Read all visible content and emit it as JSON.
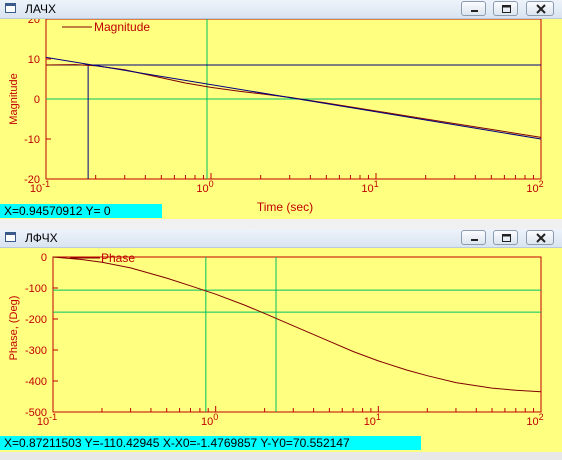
{
  "windows": [
    {
      "title": "ЛАЧХ",
      "legend": "Magnitude",
      "ylabel": "Magnitude",
      "xlabel": "Time (sec)",
      "status": "X=0.94570912  Y=       0",
      "y_ticks": [
        "20",
        "10",
        "0",
        "-10",
        "-20"
      ],
      "x_ticks": [
        {
          "base": "10",
          "exp": "-1"
        },
        {
          "base": "10",
          "exp": "0"
        },
        {
          "base": "10",
          "exp": "1"
        },
        {
          "base": "10",
          "exp": "2"
        }
      ]
    },
    {
      "title": "ЛФЧХ",
      "legend": "Phase",
      "ylabel": "Phase, (Deg)",
      "xlabel": "",
      "status": "X=0.87211503  Y=-110.42945 X-X0=-1.4769857 Y-Y0=70.552147",
      "y_ticks": [
        "0",
        "-100",
        "-200",
        "-300",
        "-400",
        "-500"
      ],
      "x_ticks": [
        {
          "base": "10",
          "exp": "-1"
        },
        {
          "base": "10",
          "exp": "0"
        },
        {
          "base": "10",
          "exp": "1"
        },
        {
          "base": "10",
          "exp": "2"
        }
      ]
    }
  ],
  "chart_data": [
    {
      "type": "line",
      "title": "",
      "xlabel": "Time (sec)",
      "ylabel": "Magnitude",
      "x_scale": "log",
      "xlim": [
        0.1,
        100
      ],
      "ylim": [
        -20,
        20
      ],
      "legend_placement": "top-left",
      "series": [
        {
          "name": "Magnitude",
          "color": "#800000",
          "x": [
            0.1,
            0.15,
            0.2,
            0.3,
            0.5,
            0.7,
            1,
            1.5,
            2,
            3,
            5,
            10,
            20,
            50,
            100
          ],
          "y": [
            8.5,
            8.6,
            8.3,
            7.3,
            5.3,
            4.0,
            2.9,
            1.9,
            1.3,
            0.4,
            -1.0,
            -3.0,
            -5.0,
            -7.6,
            -9.6
          ]
        },
        {
          "name": "",
          "color": "#000080",
          "x": [
            0.1,
            100
          ],
          "y": [
            10.4,
            -10.0
          ]
        }
      ],
      "cursor_lines": {
        "vertical_black": 0.18,
        "vertical_green": 0.9457,
        "horizontal_black": 8.5,
        "horizontal_green": 0
      }
    },
    {
      "type": "line",
      "title": "",
      "xlabel": "",
      "ylabel": "Phase, (Deg)",
      "x_scale": "log",
      "xlim": [
        0.1,
        100
      ],
      "ylim": [
        -500,
        0
      ],
      "legend_placement": "top-left",
      "series": [
        {
          "name": "Phase",
          "color": "#800000",
          "x": [
            0.1,
            0.15,
            0.2,
            0.3,
            0.5,
            0.7,
            1,
            1.5,
            2,
            3,
            5,
            7,
            10,
            15,
            20,
            30,
            50,
            70,
            100
          ],
          "y": [
            0,
            -8,
            -17,
            -35,
            -68,
            -93,
            -120,
            -155,
            -182,
            -222,
            -272,
            -305,
            -335,
            -365,
            -383,
            -405,
            -423,
            -430,
            -435
          ]
        }
      ],
      "cursor_lines": {
        "vertical_green_1": 0.87,
        "vertical_green_2": 2.35,
        "horizontal_green_1": -107,
        "horizontal_green_2": -178
      }
    }
  ],
  "colors": {
    "plot_bg": "#ffff80",
    "frame": "#c00000",
    "grid": "#c00000",
    "curve": "#800000",
    "cursor_green": "#00c060",
    "status_bg": "#00ffff",
    "asymptote": "#000080"
  },
  "icons": [
    "window-icon",
    "minimize-icon",
    "maximize-icon",
    "close-icon"
  ]
}
